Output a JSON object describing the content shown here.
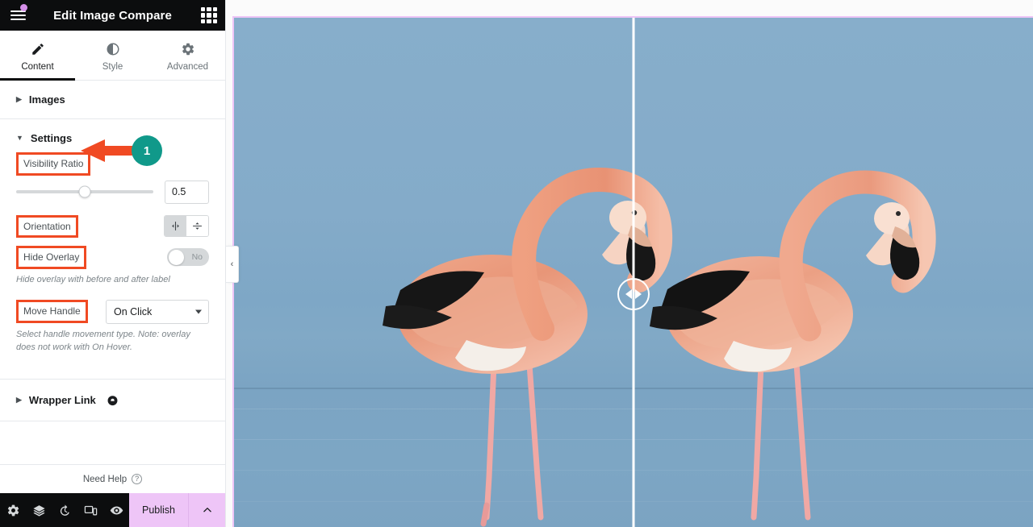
{
  "panel": {
    "header": {
      "title": "Edit Image Compare",
      "menu_icon": "hamburger-icon",
      "widgets_icon": "grid-icon"
    },
    "tabs": [
      {
        "label": "Content",
        "icon": "pencil-icon",
        "active": true
      },
      {
        "label": "Style",
        "icon": "contrast-icon",
        "active": false
      },
      {
        "label": "Advanced",
        "icon": "gear-icon",
        "active": false
      }
    ],
    "sections": [
      {
        "label": "Images",
        "expanded": false
      },
      {
        "label": "Settings",
        "expanded": true
      },
      {
        "label": "Wrapper Link",
        "expanded": false,
        "pro": true
      }
    ],
    "settings": {
      "visibility_ratio": {
        "label": "Visibility Ratio",
        "value": "0.5",
        "slider_percent": 50,
        "highlighted": true
      },
      "orientation": {
        "label": "Orientation",
        "highlighted": true,
        "options": [
          {
            "icon": "horizontal-split-icon",
            "selected": true
          },
          {
            "icon": "vertical-split-icon",
            "selected": false
          }
        ]
      },
      "hide_overlay": {
        "label": "Hide Overlay",
        "value": "No",
        "on": false,
        "highlighted": true,
        "helper": "Hide overlay with before and after label"
      },
      "move_handle": {
        "label": "Move Handle",
        "value": "On Click",
        "highlighted": true,
        "helper": "Select handle movement type. Note: overlay does not work with On Hover."
      }
    },
    "need_help": {
      "label": "Need Help",
      "icon": "question-icon"
    },
    "footer": {
      "icons": [
        {
          "name": "settings-gear-icon"
        },
        {
          "name": "navigator-layers-icon"
        },
        {
          "name": "history-icon"
        },
        {
          "name": "responsive-mode-icon"
        },
        {
          "name": "preview-eye-icon"
        }
      ],
      "publish_label": "Publish",
      "publish_caret_icon": "chevron-up-icon"
    }
  },
  "canvas": {
    "collapse_icon": "chevron-left-icon",
    "widget": {
      "name": "image-compare-widget",
      "divider_percent": 50,
      "handle_icon": "drag-handle-arrows-icon"
    }
  },
  "annotations": {
    "step_badge": "1",
    "badge_color": "#10998a",
    "highlight_color": "#f04a23",
    "arrow_icon": "left-arrow-annotation"
  }
}
